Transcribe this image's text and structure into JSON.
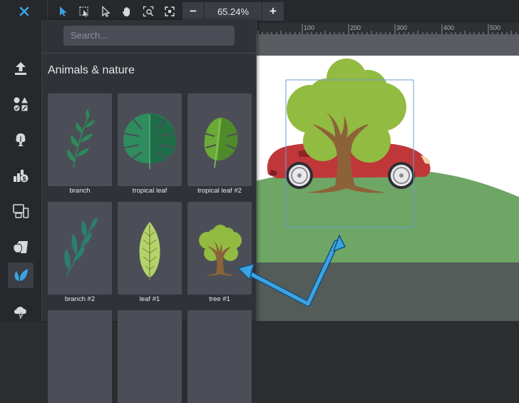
{
  "toolbar": {
    "close_icon": "close-icon",
    "tools": [
      "pointer-icon",
      "select-box-icon",
      "direct-select-icon",
      "hand-icon",
      "zoom-fit-icon",
      "fullscreen-icon"
    ],
    "zoom_out_label": "−",
    "zoom_value": "65.24%",
    "zoom_in_label": "+"
  },
  "sidebar": {
    "items": [
      "upload-icon",
      "shapes-icon",
      "tree-plant-icon",
      "finance-icon",
      "devices-icon",
      "food-icon",
      "leaf-icon",
      "weather-icon"
    ],
    "active_item": "leaf-icon"
  },
  "panel": {
    "search_placeholder": "Search...",
    "category_title": "Animals & nature",
    "items": [
      {
        "label": "branch"
      },
      {
        "label": "tropical leaf"
      },
      {
        "label": "tropical leaf #2"
      },
      {
        "label": "branch #2"
      },
      {
        "label": "leaf #1"
      },
      {
        "label": "tree #1"
      }
    ]
  },
  "ruler": {
    "labels": [
      "100",
      "200",
      "300",
      "400",
      "500"
    ]
  },
  "colors": {
    "accent": "#3aa3e3",
    "tree_foliage": "#92bb41",
    "tree_trunk": "#8c6239",
    "car_body": "#c0373a",
    "hill": "#6ea665",
    "ground": "#535c59"
  }
}
